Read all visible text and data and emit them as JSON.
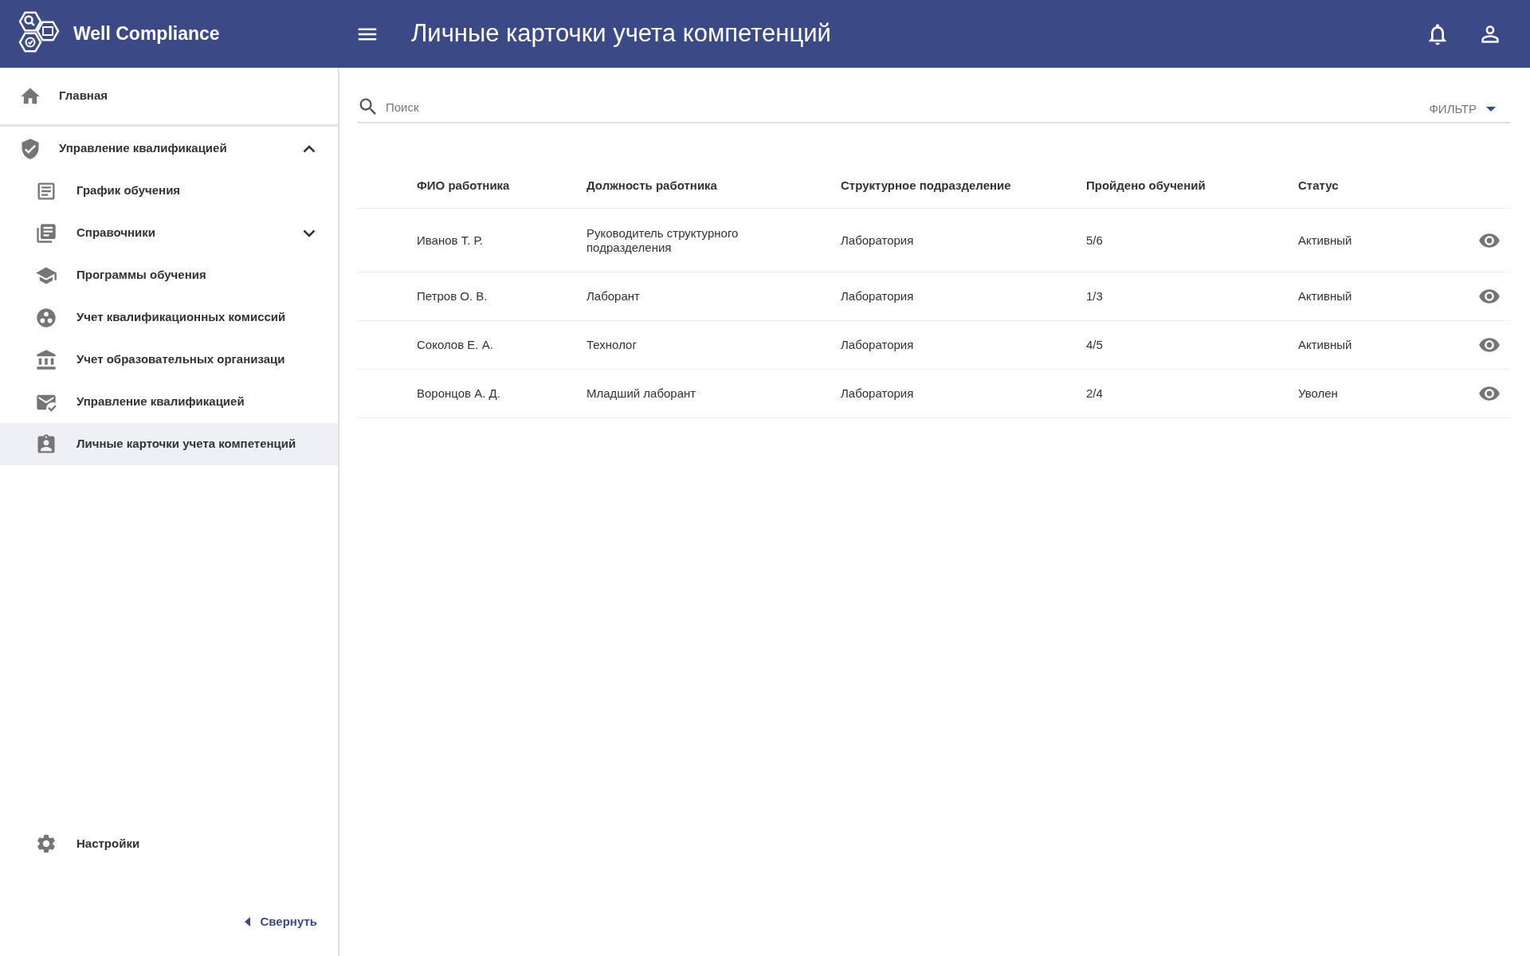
{
  "app": {
    "name": "Well Compliance"
  },
  "header": {
    "title": "Личные карточки учета компетенций"
  },
  "sidebar": {
    "home": {
      "label": "Главная",
      "selected": false
    },
    "group": {
      "label": "Управление квалификацией",
      "expanded": true,
      "selected": false,
      "children": [
        {
          "label": "График обучения",
          "selected": false
        },
        {
          "label": "Справочники",
          "selected": false,
          "expanded": false
        },
        {
          "label": "Программы обучения",
          "selected": false
        },
        {
          "label": "Учет квалификационных комиссий",
          "selected": false
        },
        {
          "label": "Учет образовательных организаци",
          "selected": false
        },
        {
          "label": "Управление квалификацией",
          "selected": false
        },
        {
          "label": "Личные карточки учета компетенций",
          "selected": true
        }
      ]
    },
    "settings": {
      "label": "Настройки",
      "selected": false
    },
    "collapse": {
      "label": "Свернуть"
    }
  },
  "search": {
    "placeholder": "Поиск"
  },
  "filter": {
    "label": "ФИЛЬТР"
  },
  "table": {
    "columns": [
      "ФИО работника",
      "Должность работника",
      "Структурное подразделение",
      "Пройдено обучений",
      "Статус"
    ],
    "rows": [
      {
        "cells": [
          "Иванов Т. Р.",
          "Руководитель структурного подразделения",
          "Лаборатория",
          "5/6",
          "Активный"
        ]
      },
      {
        "cells": [
          "Петров О. В.",
          "Лаборант",
          "Лаборатория",
          "1/3",
          "Активный"
        ]
      },
      {
        "cells": [
          "Соколов Е. А.",
          "Технолог",
          "Лаборатория",
          "4/5",
          "Активный"
        ]
      },
      {
        "cells": [
          "Воронцов А. Д.",
          "Младший лаборант",
          "Лаборатория",
          "2/4",
          "Уволен"
        ]
      }
    ]
  }
}
